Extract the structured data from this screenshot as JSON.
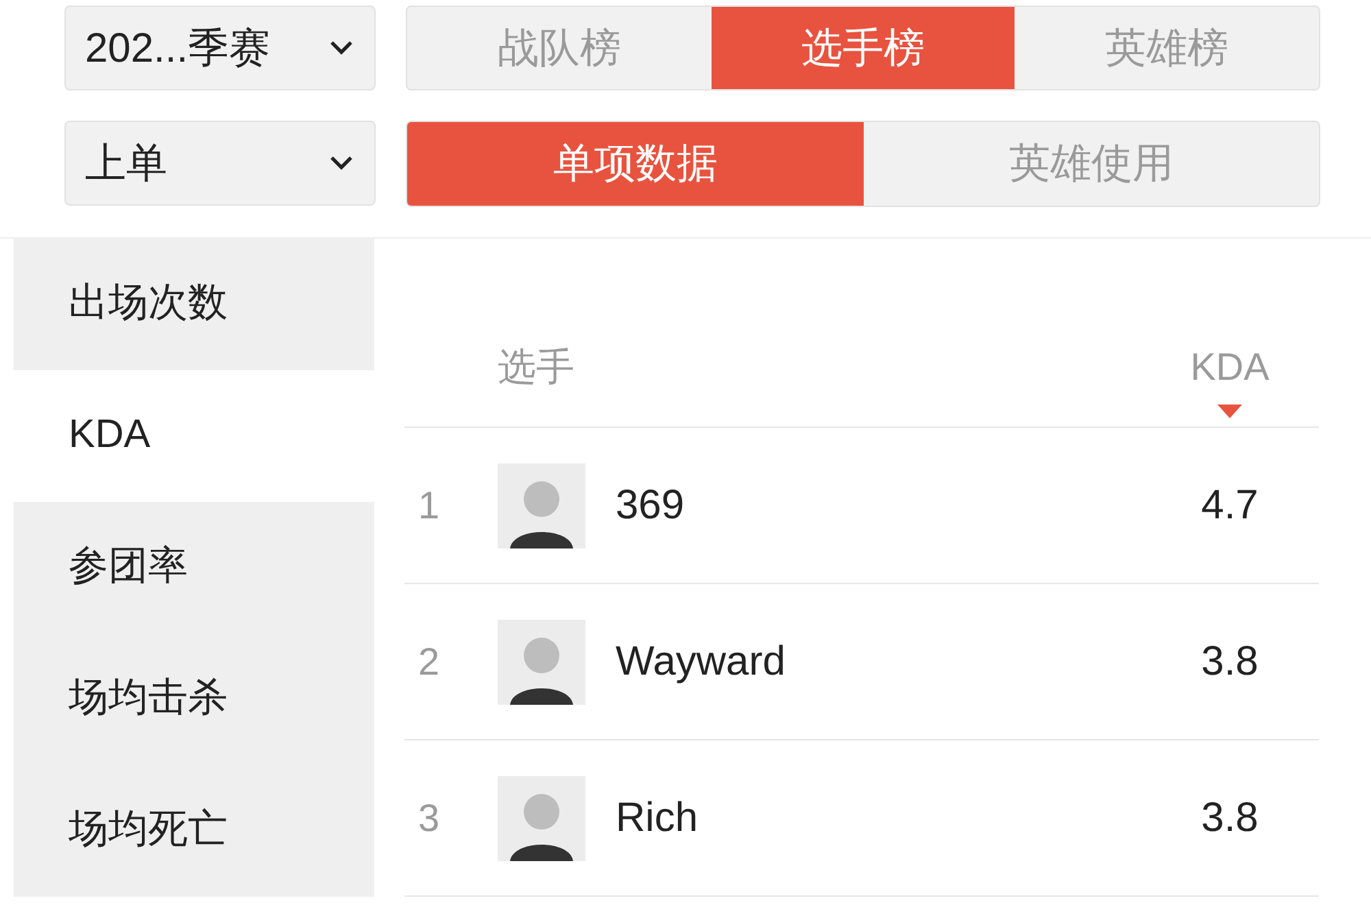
{
  "filters": [
    {
      "value": "202...季赛"
    },
    {
      "value": "上单"
    }
  ],
  "board_tabs": [
    {
      "label": "战队榜",
      "selected": false
    },
    {
      "label": "选手榜",
      "selected": true
    },
    {
      "label": "英雄榜",
      "selected": false
    }
  ],
  "data_tabs": [
    {
      "label": "单项数据",
      "selected": true
    },
    {
      "label": "英雄使用",
      "selected": false
    }
  ],
  "sidebar": {
    "items": [
      {
        "label": "出场次数",
        "selected": false
      },
      {
        "label": "KDA",
        "selected": true
      },
      {
        "label": "参团率",
        "selected": false
      },
      {
        "label": "场均击杀",
        "selected": false
      },
      {
        "label": "场均死亡",
        "selected": false
      }
    ]
  },
  "table": {
    "columns": [
      {
        "label": "选手",
        "sorted": false
      },
      {
        "label": "KDA",
        "sorted": true
      }
    ],
    "rows": [
      {
        "rank": "1",
        "player": "369",
        "kda": "4.7"
      },
      {
        "rank": "2",
        "player": "Wayward",
        "kda": "3.8"
      },
      {
        "rank": "3",
        "player": "Rich",
        "kda": "3.8"
      }
    ]
  }
}
